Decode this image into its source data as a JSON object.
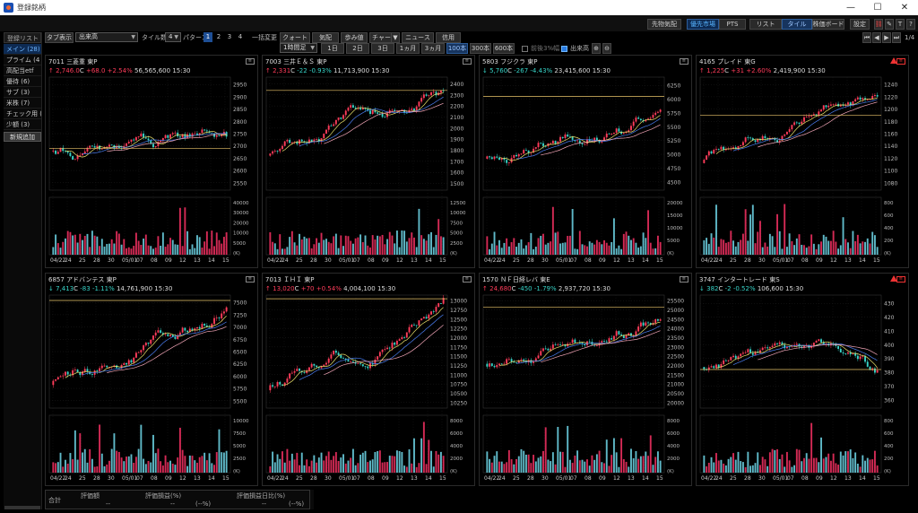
{
  "window": {
    "title": "登録銘柄",
    "minimize": "—",
    "maximize": "☐",
    "close": "✕"
  },
  "topbar": {
    "btn1": "先物気配",
    "btn2": "優先市場",
    "btn3": "PTS",
    "btn4": "リスト",
    "btn5": "タイル",
    "btn6": "株価ボード",
    "btn7": "設定",
    "icon_t": "T",
    "icon_q": "?"
  },
  "sidebar": {
    "header": "登録リスト",
    "items": [
      "メイン (28)",
      "プライム (4",
      "高配当etf",
      "優待 (6)",
      "サブ (3)",
      "米株 (7)",
      "チェック用 (",
      "少額 (3)"
    ],
    "add": "新規追加"
  },
  "toolbar1": {
    "tab_label": "タブ表示",
    "tab_value": "出来高",
    "tile_label": "タイル数",
    "tile_value": "4",
    "pattern_label": "パターン",
    "patterns": [
      "1",
      "2",
      "3",
      "4"
    ],
    "bulk_label": "一括変更",
    "b_quote": "クォート",
    "b_kehai": "気配",
    "b_bu": "歩み値",
    "b_chart": "チャート",
    "b_news": "ニュース",
    "b_credit": "信用",
    "page": "1/4"
  },
  "toolbar2": {
    "interval": "1時間足",
    "ranges": [
      "1日",
      "2日",
      "3日",
      "1ヵ月",
      "3ヵ月",
      "100本",
      "300本",
      "600本"
    ],
    "limit_label": "前後3%幅",
    "volume_label": "出来高"
  },
  "colors": {
    "up": "#ff3c5a",
    "down": "#37d4c8",
    "ma_short": "#e9e06a",
    "ma_mid": "#4a7df0",
    "ma_long": "#f3a6b8"
  },
  "panels": [
    {
      "code": "7011",
      "name": "三菱重",
      "market": "東P",
      "arrow": "↑",
      "price": "2,746.0",
      "cflag": "C",
      "change": "+68.0",
      "pct": "+2.54%",
      "volume": "56,565,600",
      "time": "15:30",
      "dir": "up",
      "tag": "",
      "warn": false,
      "yticks": [
        2950,
        2900,
        2850,
        2800,
        2750,
        2700,
        2650,
        2600,
        2550
      ],
      "vticks": [
        "40000",
        "30000",
        "20000",
        "10000",
        "5000",
        "(K)"
      ],
      "xlabels": [
        "04/22",
        "24",
        "25",
        "28",
        "30",
        "05/01",
        "07",
        "08",
        "09",
        "12",
        "13",
        "14",
        "15"
      ],
      "hline": 2690
    },
    {
      "code": "7003",
      "name": "三井Ｅ＆Ｓ",
      "market": "東P",
      "arrow": "↑",
      "price": "2,331",
      "cflag": "C",
      "change": "-22",
      "pct": "-0.93%",
      "volume": "11,713,900",
      "time": "15:30",
      "dir": "down",
      "tag": "",
      "warn": false,
      "yticks": [
        2400,
        2300,
        2200,
        2100,
        2000,
        1900,
        1800,
        1700,
        1600,
        1500
      ],
      "vticks": [
        "12500",
        "10000",
        "7500",
        "5000",
        "2500",
        "(K)"
      ],
      "xlabels": [
        "04/22",
        "24",
        "25",
        "28",
        "30",
        "05/01",
        "07",
        "08",
        "09",
        "12",
        "13",
        "14",
        "15"
      ],
      "hline": 2340
    },
    {
      "code": "5803",
      "name": "フジクラ",
      "market": "東P",
      "arrow": "↓",
      "price": "5,760",
      "cflag": "C",
      "change": "-267",
      "pct": "-4.43%",
      "volume": "23,415,600",
      "time": "15:30",
      "dir": "down",
      "tag": "",
      "warn": false,
      "yticks": [
        6250,
        6000,
        5750,
        5500,
        5250,
        5000,
        4750,
        4500
      ],
      "vticks": [
        "20000",
        "15000",
        "10000",
        "5000",
        "(K)"
      ],
      "xlabels": [
        "04/22",
        "24",
        "25",
        "28",
        "30",
        "05/01",
        "07",
        "08",
        "09",
        "12",
        "13",
        "14",
        "15"
      ],
      "hline": 6050
    },
    {
      "code": "4165",
      "name": "プレイド",
      "market": "東G",
      "arrow": "↑",
      "price": "1,225",
      "cflag": "C",
      "change": "+31",
      "pct": "+2.60%",
      "volume": "2,419,900",
      "time": "15:30",
      "dir": "up",
      "tag": "red",
      "warn": true,
      "yticks": [
        1240,
        1220,
        1200,
        1180,
        1160,
        1140,
        1120,
        1100,
        1080
      ],
      "vticks": [
        "800",
        "600",
        "400",
        "200",
        "(K)"
      ],
      "xlabels": [
        "04/22",
        "24",
        "25",
        "28",
        "30",
        "05/01",
        "07",
        "08",
        "09",
        "12",
        "13",
        "14",
        "15"
      ],
      "hline": 1190
    },
    {
      "code": "6857",
      "name": "アドバンテス",
      "market": "東P",
      "arrow": "↓",
      "price": "7,413",
      "cflag": "C",
      "change": "-83",
      "pct": "-1.11%",
      "volume": "14,761,900",
      "time": "15:30",
      "dir": "down",
      "tag": "",
      "warn": false,
      "yticks": [
        7500,
        7250,
        7000,
        6750,
        6500,
        6250,
        6000,
        5750,
        5500
      ],
      "vticks": [
        "10000",
        "7500",
        "5000",
        "2500",
        "(K)"
      ],
      "xlabels": [
        "04/22",
        "24",
        "25",
        "28",
        "30",
        "05/01",
        "07",
        "08",
        "09",
        "12",
        "13",
        "14",
        "15"
      ],
      "hline": 7540
    },
    {
      "code": "7013",
      "name": "ＩＨＩ",
      "market": "東P",
      "arrow": "↑",
      "price": "13,020",
      "cflag": "C",
      "change": "+70",
      "pct": "+0.54%",
      "volume": "4,004,100",
      "time": "15:30",
      "dir": "up",
      "tag": "",
      "warn": false,
      "yticks": [
        13000,
        12750,
        12500,
        12250,
        12000,
        11750,
        11500,
        11250,
        11000,
        10750,
        10500,
        10250
      ],
      "vticks": [
        "8000",
        "6000",
        "4000",
        "2000",
        "(K)"
      ],
      "xlabels": [
        "04/22",
        "24",
        "25",
        "28",
        "30",
        "05/01",
        "07",
        "08",
        "09",
        "12",
        "13",
        "14",
        "15"
      ],
      "hline": 13050
    },
    {
      "code": "1570",
      "name": "ＮＦ日経レバ",
      "market": "東E",
      "arrow": "↑",
      "price": "24,680",
      "cflag": "C",
      "change": "-450",
      "pct": "-1.79%",
      "volume": "2,937,720",
      "time": "15:30",
      "dir": "down",
      "tag": "",
      "warn": false,
      "yticks": [
        25500,
        25000,
        24500,
        24000,
        23500,
        23000,
        22500,
        22000,
        21500,
        21000,
        20500,
        20000
      ],
      "vticks": [
        "8000",
        "6000",
        "4000",
        "2000",
        "(K)"
      ],
      "xlabels": [
        "04/22",
        "24",
        "25",
        "28",
        "30",
        "05/01",
        "07",
        "08",
        "09",
        "12",
        "13",
        "14",
        "15"
      ],
      "hline": 25150
    },
    {
      "code": "3747",
      "name": "インタートレード",
      "market": "東S",
      "arrow": "↓",
      "price": "382",
      "cflag": "C",
      "change": "-2",
      "pct": "-0.52%",
      "volume": "106,600",
      "time": "15:30",
      "dir": "down",
      "tag": "red",
      "warn": true,
      "yticks": [
        430,
        420,
        410,
        400,
        390,
        380,
        370,
        360
      ],
      "vticks": [
        "800",
        "600",
        "400",
        "200",
        "(K)"
      ],
      "xlabels": [
        "04/22",
        "24",
        "25",
        "28",
        "30",
        "05/01",
        "07",
        "08",
        "09",
        "12",
        "13",
        "14",
        "15"
      ],
      "hline": 382
    }
  ],
  "footer": {
    "total": "合計",
    "h1": "評価額",
    "h2": "評価損益(%)",
    "h3": "評価損益日比(%)",
    "v1": "--",
    "v2": "--",
    "v3": "(--%)",
    "v4": "--",
    "v5": "(--%)"
  }
}
